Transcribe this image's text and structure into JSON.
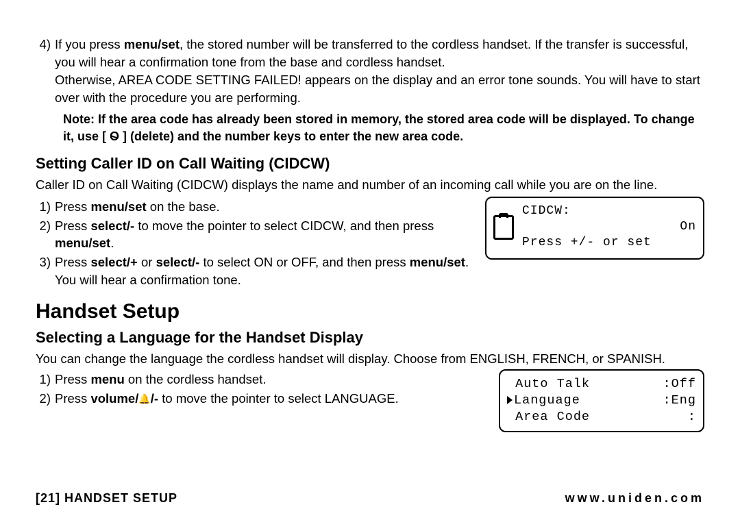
{
  "item4": {
    "num": "4)",
    "p1a": "If you press ",
    "p1b": "menu/set",
    "p1c": ", the stored number will be transferred to the cordless handset. If the transfer is successful, you will hear a confirmation tone from the base and cordless handset.",
    "p2": "Otherwise, AREA CODE SETTING FAILED! appears on the display and an error tone sounds. You will have to start over with the procedure you are performing."
  },
  "note": {
    "a": "Note:  If the area code has already been stored in memory, the stored area code will be displayed. To change it, use [ ",
    "b": " ] (delete) and the number keys to enter the new area code."
  },
  "cidcw": {
    "heading": "Setting Caller ID on Call Waiting (CIDCW)",
    "intro": "Caller ID on Call Waiting (CIDCW) displays the name and number of an incoming call while you are on the line.",
    "s1": {
      "num": "1)",
      "a": "Press ",
      "b": "menu/set",
      "c": " on the base."
    },
    "s2": {
      "num": "2)",
      "a": "Press ",
      "b": "select/-",
      "c": " to move the pointer to select CIDCW, and then press ",
      "d": "menu/set",
      "e": "."
    },
    "s3": {
      "num": "3)",
      "a": "Press ",
      "b": "select/+",
      "c": " or ",
      "d": "select/-",
      "e": "  to select ON or OFF, and then press ",
      "f": "menu/set",
      "g": ". You will hear a confirmation tone."
    }
  },
  "lcd1": {
    "line1": "CIDCW:",
    "line2_right": "On",
    "line3": "Press +/- or set"
  },
  "handset": {
    "heading": "Handset Setup",
    "sub": "Selecting a Language for the Handset Display",
    "intro": "You can change the language the cordless handset will display. Choose from ENGLISH, FRENCH, or SPANISH.",
    "s1": {
      "num": "1)",
      "a": "Press ",
      "b": "menu",
      "c": " on the cordless handset."
    },
    "s2": {
      "num": "2)",
      "a": "Press ",
      "b": "volume/",
      "c": "/-",
      "d": " to move the pointer to select LANGUAGE."
    }
  },
  "lcd2": {
    "rows": [
      {
        "left": " Auto Talk",
        "right": ":Off"
      },
      {
        "left_marker": true,
        "left": "Language",
        "right": ":Eng"
      },
      {
        "left": " Area Code",
        "right": ":"
      }
    ]
  },
  "footer": {
    "page": "[21]",
    "section": "HANDSET SETUP",
    "url": "www.uniden.com"
  }
}
